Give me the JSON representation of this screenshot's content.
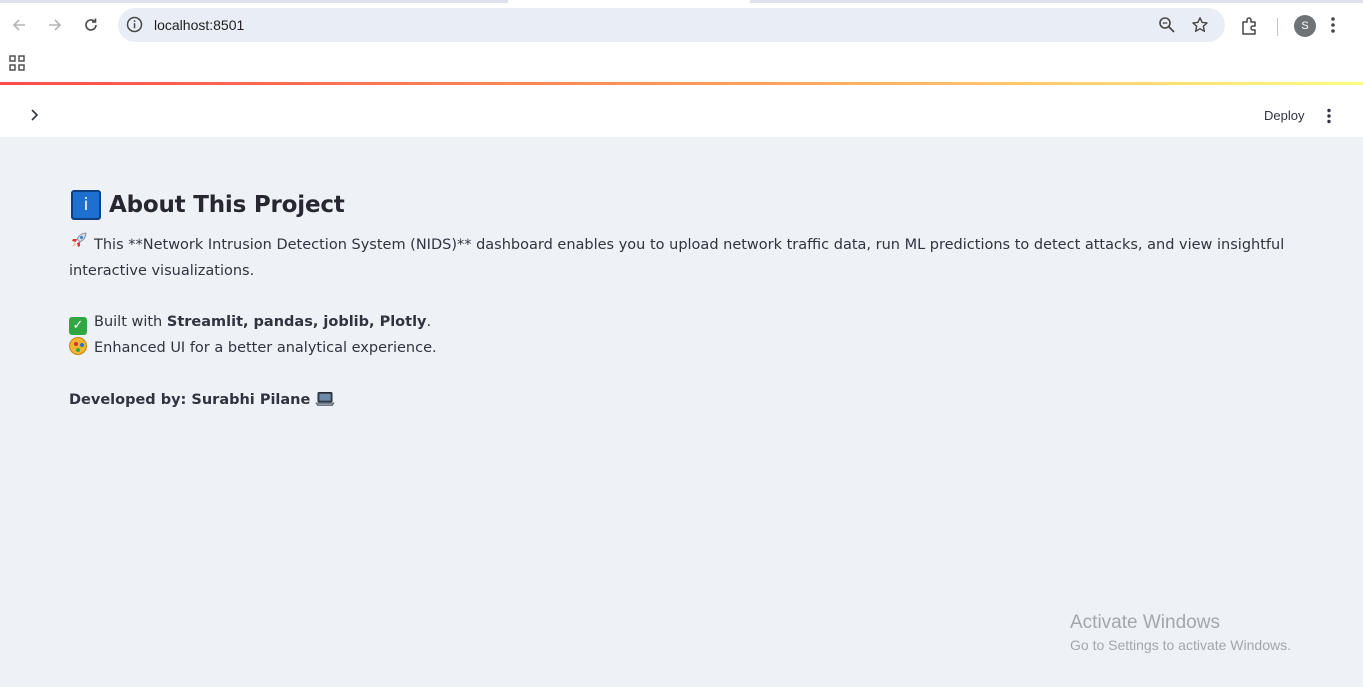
{
  "browser": {
    "url": "localhost:8501",
    "profile_initial": "S"
  },
  "app": {
    "deploy_label": "Deploy"
  },
  "page": {
    "title_icon": "i",
    "title": "About This Project",
    "description": "This **Network Intrusion Detection System (NIDS)** dashboard enables you to upload network traffic data, run ML predictions to detect attacks, and view insightful interactive visualizations.",
    "built_with_prefix": "Built with ",
    "built_with_tools": "Streamlit, pandas, joblib, Plotly",
    "built_with_suffix": ".",
    "enhanced_ui": "Enhanced UI for a better analytical experience.",
    "developer": "Developed by: Surabhi Pilane"
  },
  "icons": {
    "description": "rocket-icon",
    "built_with": "check-mark-icon",
    "enhanced_ui": "artist-palette-icon",
    "developer": "laptop-icon"
  },
  "watermark": {
    "line1": "Activate Windows",
    "line2": "Go to Settings to activate Windows."
  }
}
